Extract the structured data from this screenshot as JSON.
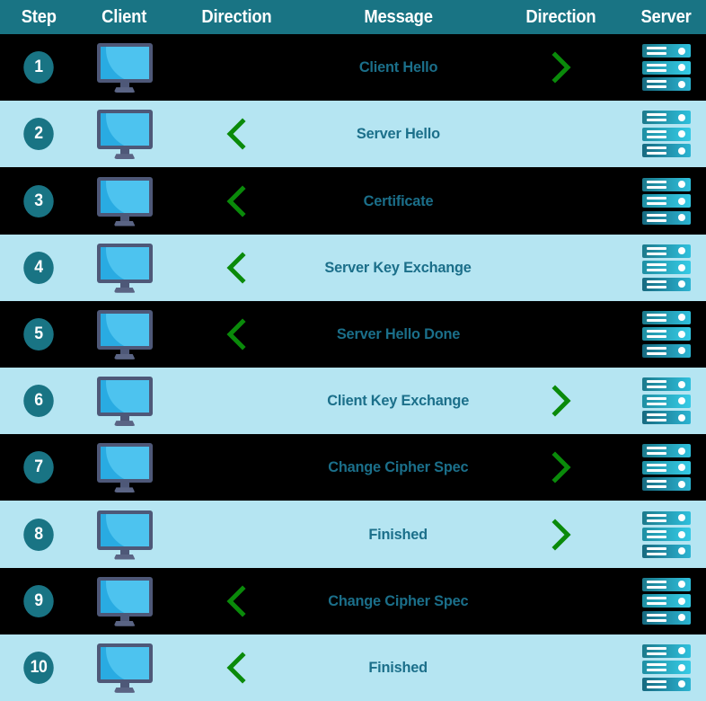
{
  "table": {
    "columns": [
      {
        "key": "step",
        "label": "Step"
      },
      {
        "key": "client",
        "label": "Client"
      },
      {
        "key": "dir_left",
        "label": "Direction"
      },
      {
        "key": "message",
        "label": "Message"
      },
      {
        "key": "dir_right",
        "label": "Direction"
      },
      {
        "key": "server",
        "label": "Server"
      }
    ],
    "rows": [
      {
        "step": "1",
        "message": "Client Hello",
        "direction": "right",
        "row_style": "dark",
        "client_icon": "monitor-icon",
        "server_icon": "server-icon"
      },
      {
        "step": "2",
        "message": "Server Hello",
        "direction": "left",
        "row_style": "light",
        "client_icon": "monitor-icon",
        "server_icon": "server-icon"
      },
      {
        "step": "3",
        "message": "Certificate",
        "direction": "left",
        "row_style": "dark",
        "client_icon": "monitor-icon",
        "server_icon": "server-icon"
      },
      {
        "step": "4",
        "message": "Server Key Exchange",
        "direction": "left",
        "row_style": "light",
        "client_icon": "monitor-icon",
        "server_icon": "server-icon"
      },
      {
        "step": "5",
        "message": "Server Hello Done",
        "direction": "left",
        "row_style": "dark",
        "client_icon": "monitor-icon",
        "server_icon": "server-icon"
      },
      {
        "step": "6",
        "message": "Client Key Exchange",
        "direction": "right",
        "row_style": "light",
        "client_icon": "monitor-icon",
        "server_icon": "server-icon"
      },
      {
        "step": "7",
        "message": "Change Cipher Spec",
        "direction": "right",
        "row_style": "dark",
        "client_icon": "monitor-icon",
        "server_icon": "server-icon"
      },
      {
        "step": "8",
        "message": "Finished",
        "direction": "right",
        "row_style": "light",
        "client_icon": "monitor-icon",
        "server_icon": "server-icon"
      },
      {
        "step": "9",
        "message": "Change Cipher Spec",
        "direction": "left",
        "row_style": "dark",
        "client_icon": "monitor-icon",
        "server_icon": "server-icon"
      },
      {
        "step": "10",
        "message": "Finished",
        "direction": "left",
        "row_style": "light",
        "client_icon": "monitor-icon",
        "server_icon": "server-icon"
      }
    ]
  },
  "colors": {
    "header_bg": "#197484",
    "header_text": "#ffffff",
    "row_dark_bg": "#000000",
    "row_light_bg": "#b5e5f2",
    "message_text": "#1b6f8a",
    "step_circle_bg": "#197484",
    "step_circle_text": "#ffffff",
    "arrow_green": "#0a8a0a",
    "monitor_frame": "#4e5878",
    "monitor_screen": "#29abe2",
    "monitor_screen_highlight": "#4dc3ef",
    "server_bar_start": "#1c7a8c",
    "server_bar_end": "#2ec0dd"
  }
}
